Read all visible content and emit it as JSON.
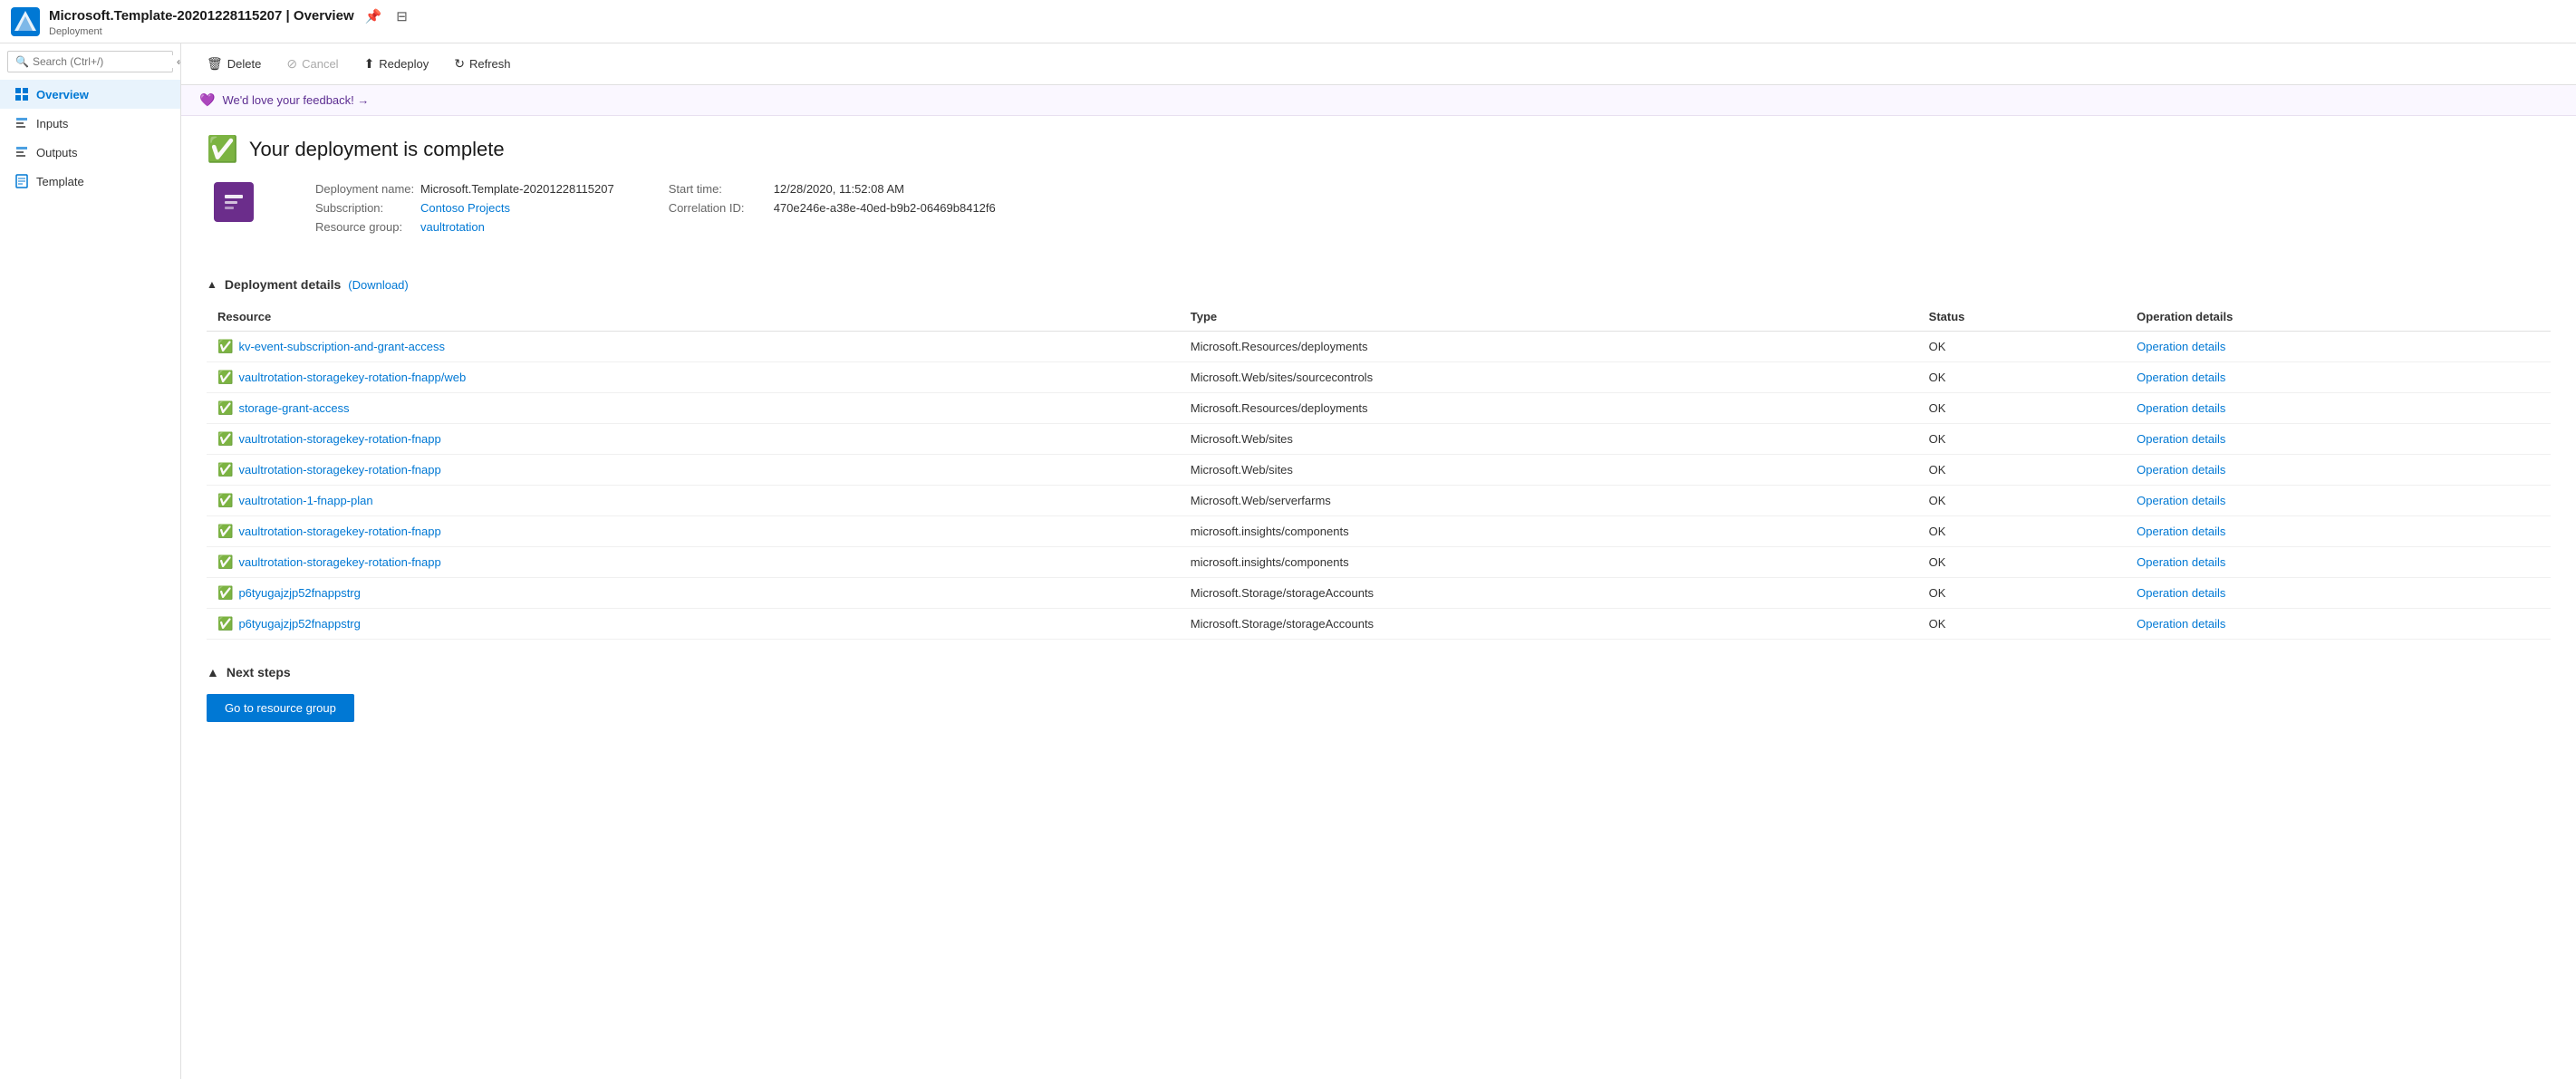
{
  "topbar": {
    "title": "Microsoft.Template-20201228115207 | Overview",
    "subtitle": "Deployment",
    "pin_icon": "📌",
    "print_icon": "🖨"
  },
  "search": {
    "placeholder": "Search (Ctrl+/)"
  },
  "sidebar": {
    "items": [
      {
        "id": "overview",
        "label": "Overview",
        "active": true
      },
      {
        "id": "inputs",
        "label": "Inputs",
        "active": false
      },
      {
        "id": "outputs",
        "label": "Outputs",
        "active": false
      },
      {
        "id": "template",
        "label": "Template",
        "active": false
      }
    ]
  },
  "toolbar": {
    "delete_label": "Delete",
    "cancel_label": "Cancel",
    "redeploy_label": "Redeploy",
    "refresh_label": "Refresh"
  },
  "feedback": {
    "text": "We'd love your feedback! →"
  },
  "deployment": {
    "status_text": "Your deployment is complete",
    "name_label": "Deployment name:",
    "name_value": "Microsoft.Template-20201228115207",
    "subscription_label": "Subscription:",
    "subscription_value": "Contoso Projects",
    "resource_group_label": "Resource group:",
    "resource_group_value": "vaultrotation",
    "start_time_label": "Start time:",
    "start_time_value": "12/28/2020, 11:52:08 AM",
    "correlation_label": "Correlation ID:",
    "correlation_value": "470e246e-a38e-40ed-b9b2-06469b8412f6"
  },
  "deployment_details": {
    "section_label": "Deployment details",
    "download_label": "(Download)",
    "columns": [
      "Resource",
      "Type",
      "Status",
      "Operation details"
    ],
    "rows": [
      {
        "resource": "kv-event-subscription-and-grant-access",
        "type": "Microsoft.Resources/deployments",
        "status": "OK",
        "op": "Operation details"
      },
      {
        "resource": "vaultrotation-storagekey-rotation-fnapp/web",
        "type": "Microsoft.Web/sites/sourcecontrols",
        "status": "OK",
        "op": "Operation details"
      },
      {
        "resource": "storage-grant-access",
        "type": "Microsoft.Resources/deployments",
        "status": "OK",
        "op": "Operation details"
      },
      {
        "resource": "vaultrotation-storagekey-rotation-fnapp",
        "type": "Microsoft.Web/sites",
        "status": "OK",
        "op": "Operation details"
      },
      {
        "resource": "vaultrotation-storagekey-rotation-fnapp",
        "type": "Microsoft.Web/sites",
        "status": "OK",
        "op": "Operation details"
      },
      {
        "resource": "vaultrotation-1-fnapp-plan",
        "type": "Microsoft.Web/serverfarms",
        "status": "OK",
        "op": "Operation details"
      },
      {
        "resource": "vaultrotation-storagekey-rotation-fnapp",
        "type": "microsoft.insights/components",
        "status": "OK",
        "op": "Operation details"
      },
      {
        "resource": "vaultrotation-storagekey-rotation-fnapp",
        "type": "microsoft.insights/components",
        "status": "OK",
        "op": "Operation details"
      },
      {
        "resource": "p6tyugajzjp52fnappstrg",
        "type": "Microsoft.Storage/storageAccounts",
        "status": "OK",
        "op": "Operation details"
      },
      {
        "resource": "p6tyugajzjp52fnappstrg",
        "type": "Microsoft.Storage/storageAccounts",
        "status": "OK",
        "op": "Operation details"
      }
    ]
  },
  "next_steps": {
    "section_label": "Next steps",
    "button_label": "Go to resource group"
  }
}
